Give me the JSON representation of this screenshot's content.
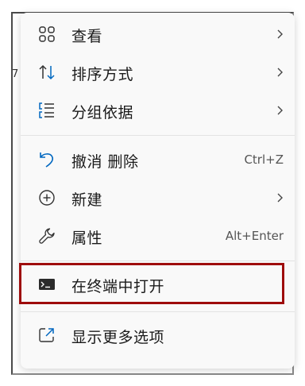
{
  "background": {
    "partial_text": "7"
  },
  "menu": {
    "items": [
      {
        "label": "查看",
        "icon": "view-grid-icon",
        "submenu": true
      },
      {
        "label": "排序方式",
        "icon": "sort-arrows-icon",
        "submenu": true
      },
      {
        "label": "分组依据",
        "icon": "group-list-icon",
        "submenu": true
      },
      {
        "label": "撤消 删除",
        "icon": "undo-icon",
        "shortcut": "Ctrl+Z"
      },
      {
        "label": "新建",
        "icon": "new-plus-icon",
        "submenu": true
      },
      {
        "label": "属性",
        "icon": "wrench-icon",
        "shortcut": "Alt+Enter"
      },
      {
        "label": "在终端中打开",
        "icon": "terminal-icon",
        "highlighted": true
      },
      {
        "label": "显示更多选项",
        "icon": "show-more-icon"
      }
    ]
  },
  "colors": {
    "accent": "#0067c0",
    "highlight_border": "#9e0c0c",
    "menu_background": "#f9f9f9"
  }
}
